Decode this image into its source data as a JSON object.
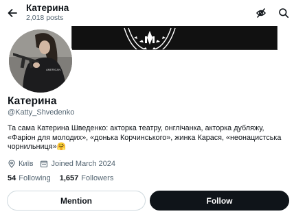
{
  "header": {
    "title": "Катерина",
    "posts_count": "2,018 posts",
    "back_icon": "back-arrow-icon",
    "hide_icon": "eye-off-icon",
    "search_icon": "search-icon"
  },
  "profile": {
    "name": "Катерина",
    "handle": "@Katty_Shvedenko",
    "bio": "Та сама Катерина Шведенко: акторка театру, онглічанка, акторка дубляжу, «Фаріон для молодих», «донька Корчинського», жинка Карася, «неонацистська чорнильниця»🤗",
    "location": "Київ",
    "joined": "Joined March 2024",
    "following_count": "54",
    "following_label": "Following",
    "followers_count": "1,657",
    "followers_label": "Followers"
  },
  "actions": {
    "mention_label": "Mention",
    "follow_label": "Follow"
  },
  "colors": {
    "text": "#0f1419",
    "secondary": "#536471",
    "border": "#cfd9de",
    "follow_bg": "#0f1419"
  }
}
